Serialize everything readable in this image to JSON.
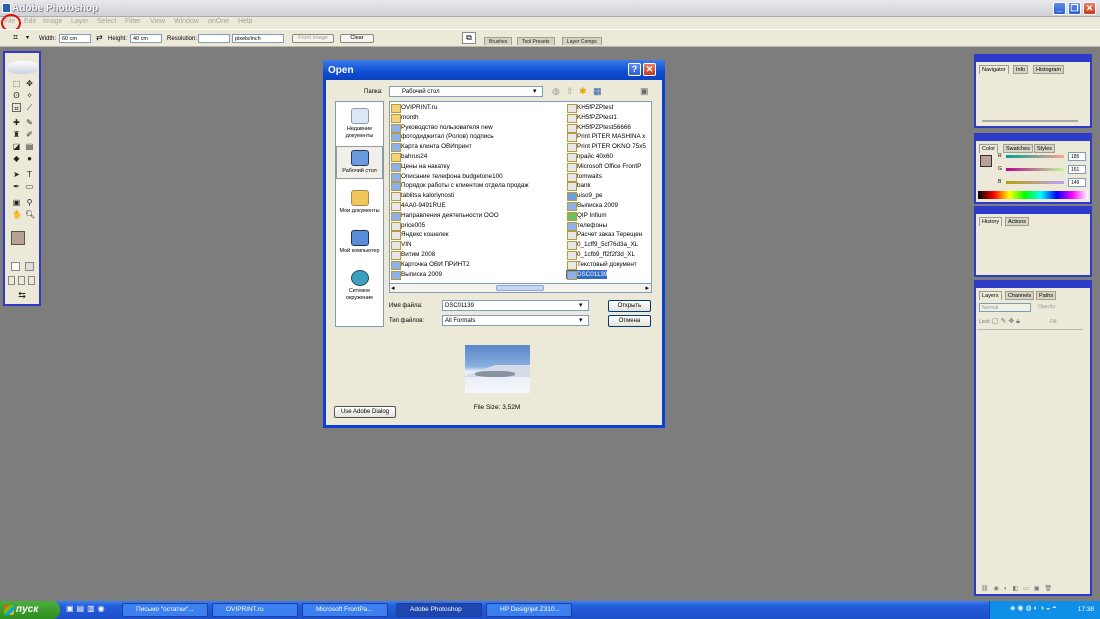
{
  "window": {
    "title": "Adobe Photoshop"
  },
  "menu": [
    "File",
    "Edit",
    "Image",
    "Layer",
    "Select",
    "Filter",
    "View",
    "Window",
    "onOne",
    "Help"
  ],
  "options": {
    "width_label": "Width:",
    "width_value": "60 cm",
    "height_label": "Height:",
    "height_value": "40 cm",
    "resolution_label": "Resolution:",
    "resolution_value": "",
    "units": "pixels/inch",
    "front_image": "Front Image",
    "clear": "Clear"
  },
  "palette_well": [
    "Brushes",
    "Tool Presets",
    "Layer Comps"
  ],
  "navigator": {
    "tabs": [
      "Navigator",
      "Info",
      "Histogram"
    ]
  },
  "color": {
    "tabs": [
      "Color",
      "Swatches",
      "Styles"
    ],
    "r_label": "R",
    "g_label": "G",
    "b_label": "B",
    "r": "185",
    "g": "161",
    "b": "149",
    "fg": "#b9a195"
  },
  "history": {
    "tabs": [
      "History",
      "Actions"
    ]
  },
  "layers": {
    "tabs": [
      "Layers",
      "Channels",
      "Paths"
    ],
    "blend": "Normal",
    "opacity_label": "Opacity:",
    "lock_label": "Lock:",
    "fill_label": "Fill:"
  },
  "dialog": {
    "title": "Open",
    "folder_label": "Папка:",
    "folder_value": "Рабочий стол",
    "places": [
      "Недавние документы",
      "Рабочий стол",
      "Мои документы",
      "Мой компьютер",
      "Сетевое окружение"
    ],
    "files_col1": [
      "OVIPRINT.ru",
      "month",
      "Руководство пользователя new",
      "фотодиджитал (Ролов) подпись",
      "Карта клинта ОВИпринт",
      "bahrus24",
      "Цены на накатку",
      "Описание телефона budgetone100",
      "Порядок работы с клиентом отдела продаж",
      "tablitsa kaloriynosti",
      "4AA0-9491RUE",
      "Направления деятельности ООО",
      "price005",
      "Яндекс кошелек",
      "VIN",
      "Витим 2008",
      "Карточка ОВИ ПРИНТ2",
      "Выписка 2009"
    ],
    "files_col2": [
      "KH5fPZPtest",
      "KH5fPZPtest1",
      "KH5fPZPtest56666",
      "Print PITER MASHINA x",
      "Print PITER OKNO 75x5",
      "прайс 40x60",
      "Microsoft Office FrontP",
      "tomwaits",
      "bank",
      "uiso9_pe",
      "Выписка 2009",
      "QIP Infium",
      "телефоны",
      "Расчет заказ Терещен",
      "0_1cff9_5cf76d3a_XL",
      "0_1cfb9_ff2f2f3d_XL",
      "Текстовый документ",
      "DSC01139"
    ],
    "filename_label": "Имя файла:",
    "filename_value": "DSC01139",
    "filetype_label": "Тип файлов:",
    "filetype_value": "All Formats",
    "open_button": "Открыть",
    "cancel_button": "Отмена",
    "file_size": "File Size: 3,52M",
    "adobe_dialog_button": "Use Adobe Dialog"
  },
  "taskbar": {
    "start": "пуск",
    "tasks": [
      "Письмо \"остатки\"...",
      "OVIPRINT.ru",
      "Microsoft FrontPa...",
      "Adobe Photoshop",
      "HP Designjet Z310..."
    ],
    "time": "17:38"
  }
}
